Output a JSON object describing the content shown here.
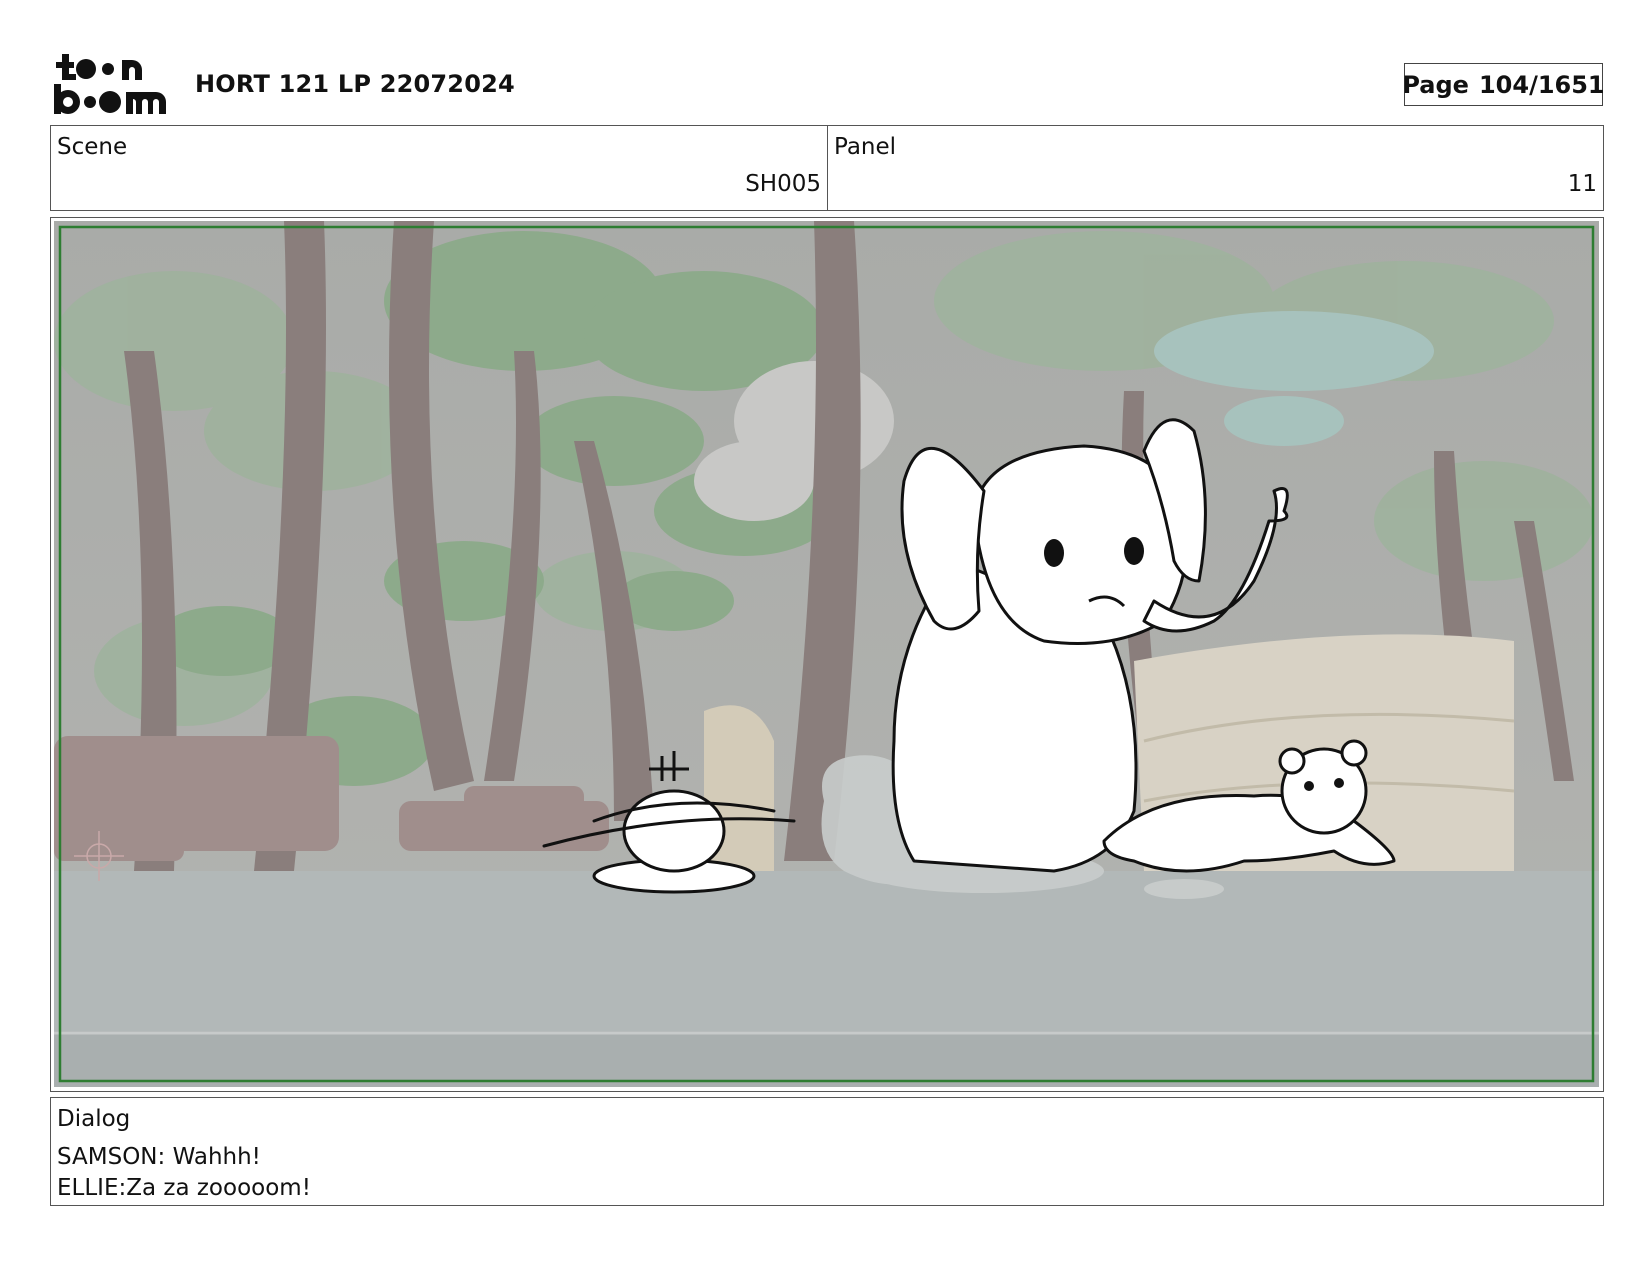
{
  "header": {
    "logo_text_top": "toon",
    "logo_text_bottom": "boom",
    "doc_title": "HORT 121 LP 22072024",
    "page_label": "Page",
    "page_number": "104/1651"
  },
  "info": {
    "scene_label": "Scene",
    "scene_value": "SH005",
    "panel_label": "Panel",
    "panel_value": "11"
  },
  "artwork": {
    "description_icon": "storyboard-panel-image",
    "safe_frame_color": "#2e7d32"
  },
  "dialog": {
    "label": "Dialog",
    "lines": [
      "SAMSON: Wahhh!",
      "ELLIE:Za za zooooom!"
    ]
  }
}
